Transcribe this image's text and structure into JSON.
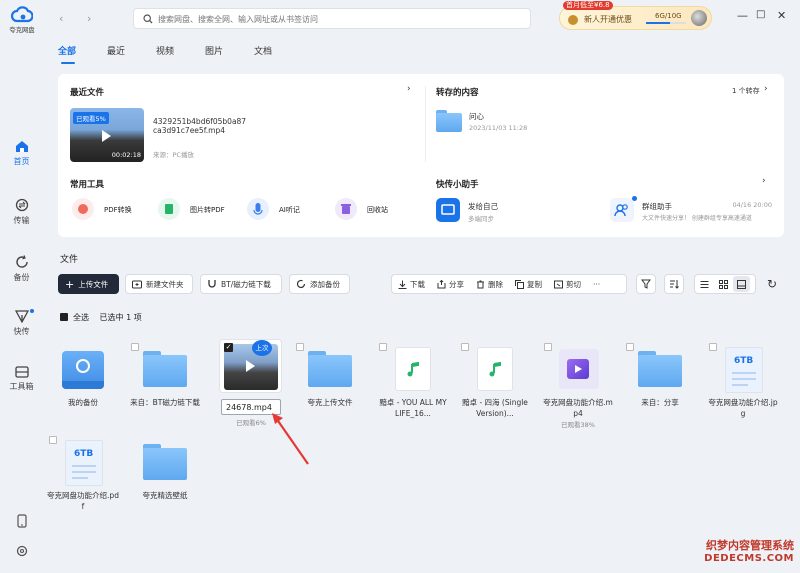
{
  "app": {
    "name": "夸克网盘"
  },
  "nav": {
    "items": [
      {
        "label": "首页"
      },
      {
        "label": "传输"
      },
      {
        "label": "备份"
      },
      {
        "label": "快传"
      },
      {
        "label": "工具箱"
      }
    ]
  },
  "search": {
    "placeholder": "搜索网盘、搜索全网、输入网址或从书签访问"
  },
  "promo": {
    "tag": "首月低至¥6.8",
    "label": "新人开通优惠",
    "storage": "6G/10G",
    "storage_fraction": 0.6
  },
  "tabs": [
    "全部",
    "最近",
    "视频",
    "图片",
    "文档"
  ],
  "recent": {
    "title": "最近文件",
    "badge": "已观看5%",
    "duration": "00:02:18",
    "filename_line1": "4329251b4bd6f05b0a87",
    "filename_line2": "ca3d91c7ee5f.mp4",
    "source": "来源：PC播放"
  },
  "saved": {
    "title": "转存的内容",
    "count": "1 个转存",
    "item_name": "问心",
    "item_time": "2023/11/03 11:28"
  },
  "tools": {
    "title": "常用工具",
    "items": [
      "PDF转换",
      "图片转PDF",
      "AI听记",
      "回收站"
    ]
  },
  "assistant": {
    "title": "快传小助手",
    "self_name": "发给自己",
    "self_sub": "多端同步",
    "group_name": "群组助手",
    "group_date": "04/16 20:00",
    "group_sub": "大文件快速分享！ 创建群组专享高速通道"
  },
  "files": {
    "title": "文件",
    "upload": "上传文件",
    "new_folder": "新建文件夹",
    "bt": "BT/磁力链下载",
    "backup": "添加备份",
    "actions": [
      "下载",
      "分享",
      "删除",
      "复制",
      "剪切",
      "···"
    ],
    "select_all": "全选",
    "selected_count": "已选中 1 项",
    "items": [
      {
        "name": "我的备份",
        "sub": ""
      },
      {
        "name": "来自：BT磁力链下载",
        "sub": ""
      },
      {
        "name": "24678.mp4",
        "sub": "已观看6%",
        "tag": "上次"
      },
      {
        "name": "夸克上传文件",
        "sub": ""
      },
      {
        "name": "黯卓 - YOU ALL MY LIFE_16...",
        "sub": ""
      },
      {
        "name": "黯卓 - 四海 (Single Version)...",
        "sub": ""
      },
      {
        "name": "夸克网盘功能介绍.mp4",
        "sub": "已观看38%"
      },
      {
        "name": "来自：分享",
        "sub": ""
      },
      {
        "name": "夸克网盘功能介绍.jpg",
        "sub": ""
      },
      {
        "name": "夸克网盘功能介绍.pdf",
        "sub": ""
      },
      {
        "name": "夸克精选壁纸",
        "sub": ""
      }
    ]
  },
  "doc_thumb_text": "6TB",
  "watermark": {
    "line1": "织梦内容管理系统",
    "line2": "DEDECMS.COM"
  }
}
